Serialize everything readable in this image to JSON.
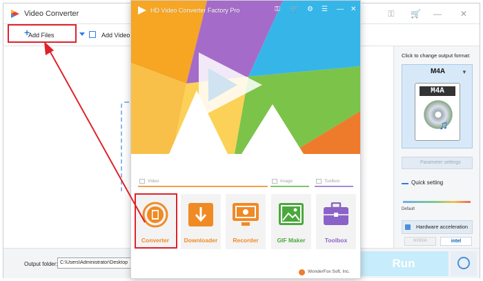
{
  "back_window": {
    "title": "Video Converter",
    "toolbar": {
      "add_files_label": "Add Files",
      "add_video_label": "Add Video Fo"
    },
    "right_panel": {
      "change_format_hint": "Click to change output format:",
      "format_name": "M4A",
      "format_icon_label": "M4A",
      "parameter_settings": "Parameter settings",
      "quick_setting": "Quick setting",
      "quality_default": "Default",
      "hardware_acceleration": "Hardware acceleration",
      "nvidia_label": "NVIDIA",
      "intel_label": "intel"
    },
    "bottom": {
      "output_label": "Output folder:",
      "output_path": "C:\\Users\\Administrator\\Desktop",
      "run_label": "Run"
    }
  },
  "front_window": {
    "title": "HD Video Converter Factory Pro",
    "sections": {
      "video": "Video",
      "image": "Image",
      "toolbox": "Toolbox"
    },
    "tiles": [
      {
        "label": "Converter",
        "color": "#f08a24",
        "icon": "converter-icon"
      },
      {
        "label": "Downloader",
        "color": "#f08a24",
        "icon": "downloader-icon"
      },
      {
        "label": "Recorder",
        "color": "#f08a24",
        "icon": "recorder-icon"
      },
      {
        "label": "GIF Maker",
        "color": "#4aa83c",
        "icon": "gif-maker-icon"
      },
      {
        "label": "Toolbox",
        "color": "#8a62c8",
        "icon": "toolbox-icon"
      }
    ],
    "footer": "WonderFox Soft, Inc."
  },
  "colors": {
    "annotation_red": "#e0202a",
    "accent_blue": "#2c7be5"
  }
}
